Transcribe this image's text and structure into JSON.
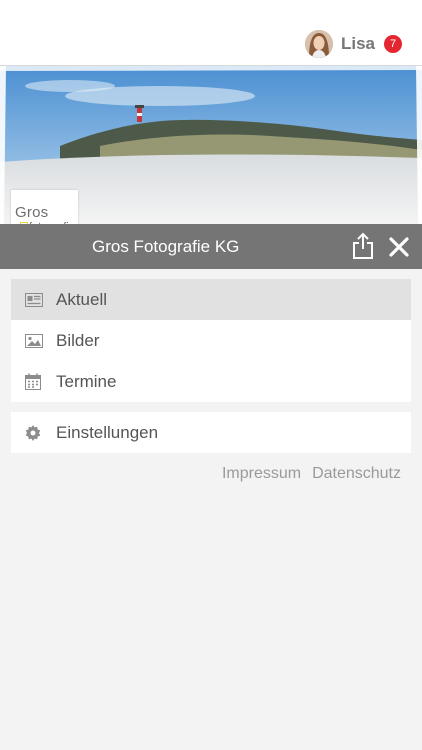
{
  "header": {
    "user_name": "Lisa",
    "notification_count": "7"
  },
  "brand": {
    "company_name": "Gros Fotografie KG",
    "logo_main": "Gros",
    "logo_sub": "fotografie"
  },
  "menu": {
    "primary": [
      {
        "label": "Aktuell",
        "icon": "newspaper-icon",
        "active": true
      },
      {
        "label": "Bilder",
        "icon": "image-icon",
        "active": false
      },
      {
        "label": "Termine",
        "icon": "calendar-icon",
        "active": false
      }
    ],
    "secondary": [
      {
        "label": "Einstellungen",
        "icon": "gear-icon",
        "active": false
      }
    ]
  },
  "footer": {
    "impressum": "Impressum",
    "datenschutz": "Datenschutz"
  },
  "colors": {
    "badge": "#e3262f",
    "titlebar": "#757575",
    "menu_background": "#f3f3f3",
    "active_item": "#e1e1e1"
  }
}
